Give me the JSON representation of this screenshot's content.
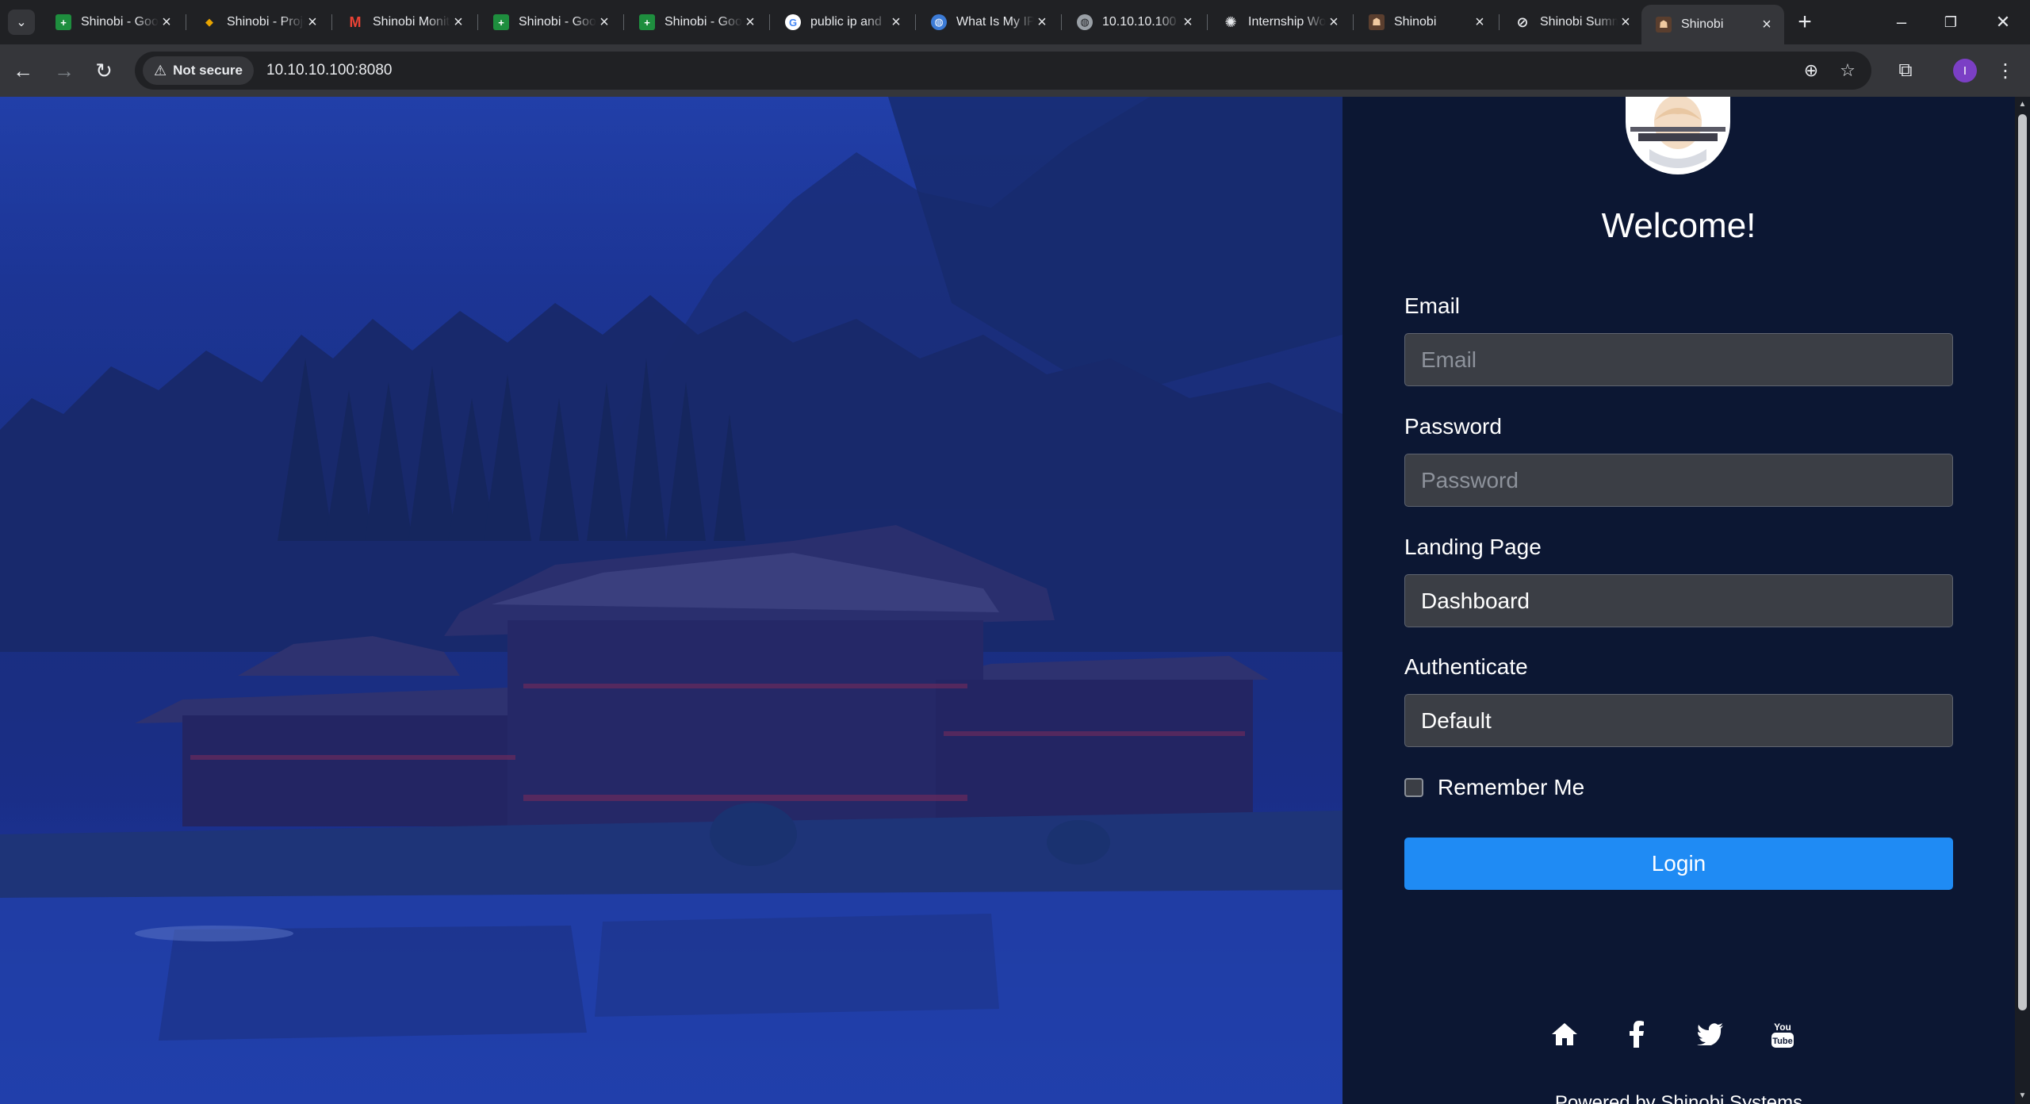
{
  "browser": {
    "tabs": [
      {
        "title": "Shinobi - Google Sheets",
        "icon": "sheets-icon",
        "color": "#1e8e3e"
      },
      {
        "title": "Shinobi - Project",
        "icon": "project-icon",
        "color": "#e8a400"
      },
      {
        "title": "Shinobi Monitoring",
        "icon": "gmail-icon",
        "color": "#ea4335"
      },
      {
        "title": "Shinobi - Google Sheets",
        "icon": "sheets-icon",
        "color": "#1e8e3e"
      },
      {
        "title": "Shinobi - Google Sheets",
        "icon": "sheets-icon",
        "color": "#1e8e3e"
      },
      {
        "title": "public ip and",
        "icon": "google-icon",
        "color": "#4285f4"
      },
      {
        "title": "What Is My IP",
        "icon": "globe-icon",
        "color": "#3c7bd6"
      },
      {
        "title": "10.10.10.100",
        "icon": "globe-icon",
        "color": "#9aa0a6"
      },
      {
        "title": "Internship Work",
        "icon": "chatgpt-icon",
        "color": "#e8eaed"
      },
      {
        "title": "Shinobi",
        "icon": "shinobi-icon",
        "color": "#c08a5a"
      },
      {
        "title": "Shinobi Summary",
        "icon": "link-icon",
        "color": "#e8eaed"
      },
      {
        "title": "Shinobi",
        "icon": "shinobi-icon",
        "color": "#c08a5a"
      }
    ],
    "active_tab_index": 11,
    "security_chip": "Not secure",
    "url": "10.10.10.100:8080",
    "profile_initial": "I",
    "profile_color": "#7b3fc5"
  },
  "login": {
    "welcome": "Welcome!",
    "email_label": "Email",
    "email_placeholder": "Email",
    "password_label": "Password",
    "password_placeholder": "Password",
    "landing_label": "Landing Page",
    "landing_value": "Dashboard",
    "auth_label": "Authenticate",
    "auth_value": "Default",
    "remember_label": "Remember Me",
    "remember_checked": false,
    "login_button": "Login",
    "accent_color": "#1f8bf4",
    "panel_color": "#0c1733"
  },
  "footer": {
    "social_icons": [
      "home-icon",
      "facebook-icon",
      "twitter-icon",
      "youtube-icon"
    ],
    "copyright": "Powered by Shinobi.Systems"
  }
}
